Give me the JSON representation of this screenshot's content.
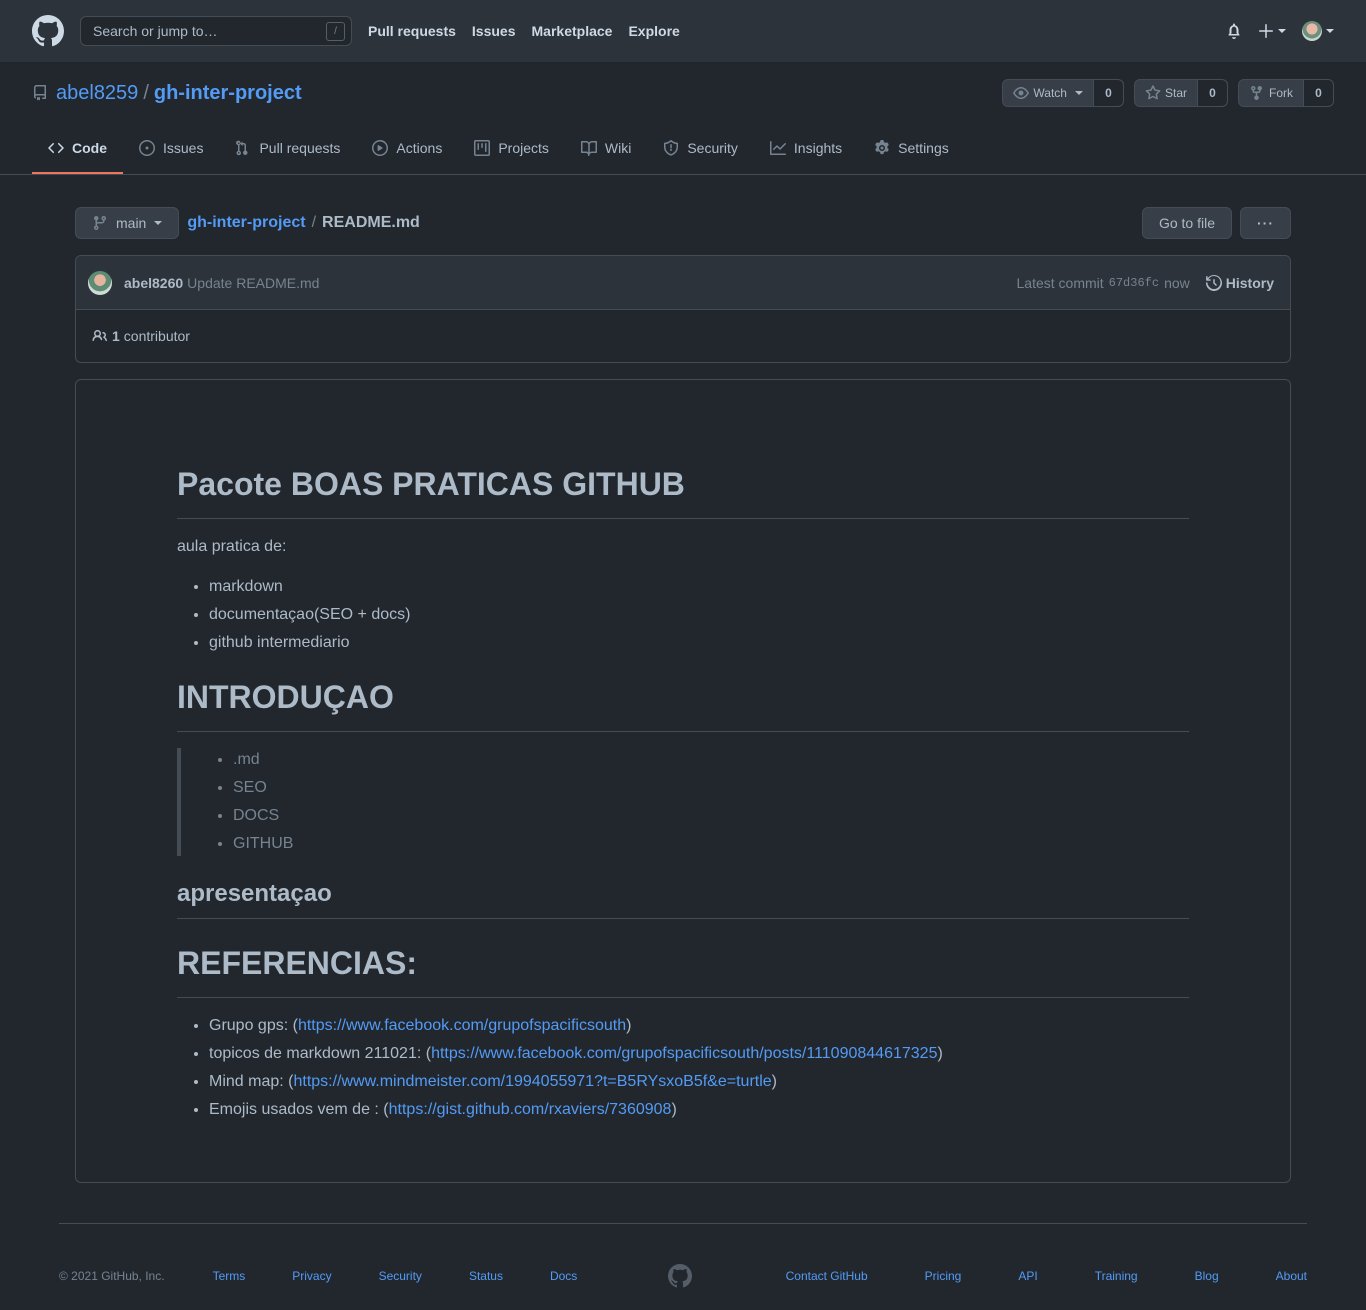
{
  "header": {
    "search_placeholder": "Search or jump to…",
    "search_key": "/",
    "nav": [
      "Pull requests",
      "Issues",
      "Marketplace",
      "Explore"
    ]
  },
  "repo": {
    "owner": "abel8259",
    "separator": "/",
    "name": "gh-inter-project",
    "watch_label": "Watch",
    "watch_count": "0",
    "star_label": "Star",
    "star_count": "0",
    "fork_label": "Fork",
    "fork_count": "0"
  },
  "tabs": [
    "Code",
    "Issues",
    "Pull requests",
    "Actions",
    "Projects",
    "Wiki",
    "Security",
    "Insights",
    "Settings"
  ],
  "file_nav": {
    "branch": "main",
    "root": "gh-inter-project",
    "separator": "/",
    "file": "README.md",
    "go_to_file": "Go to file",
    "more": "···"
  },
  "commit": {
    "author": "abel8260",
    "message": "Update README.md",
    "latest_label": "Latest commit",
    "sha": "67d36fc",
    "time": "now",
    "history_label": "History",
    "contributors_count": "1",
    "contributors_label": "contributor"
  },
  "readme": {
    "title": "Pacote BOAS PRATICAS GITHUB",
    "intro_text": "aula pratica de:",
    "topics": [
      "markdown",
      "documentaçao(SEO + docs)",
      "github intermediario"
    ],
    "intro_heading": "INTRODUÇAO",
    "quote_items": [
      ".md",
      "SEO",
      "DOCS",
      "GITHUB"
    ],
    "presentation_heading": "apresentaçao",
    "references_heading": "REFERENCIAS:",
    "references": [
      {
        "label": "Grupo gps: (",
        "url": "https://www.facebook.com/grupofspacificsouth",
        "suffix": ")"
      },
      {
        "label": "topicos de markdown 211021: (",
        "url": "https://www.facebook.com/grupofspacificsouth/posts/111090844617325",
        "suffix": ")"
      },
      {
        "label": "Mind map: (",
        "url": "https://www.mindmeister.com/1994055971?t=B5RYsxoB5f&e=turtle",
        "suffix": ")"
      },
      {
        "label": "Emojis usados vem de : (",
        "url": "https://gist.github.com/rxaviers/7360908",
        "suffix": ")"
      }
    ]
  },
  "footer": {
    "copyright": "© 2021 GitHub, Inc.",
    "left_links": [
      "Terms",
      "Privacy",
      "Security",
      "Status",
      "Docs"
    ],
    "right_links": [
      "Contact GitHub",
      "Pricing",
      "API",
      "Training",
      "Blog",
      "About"
    ]
  }
}
